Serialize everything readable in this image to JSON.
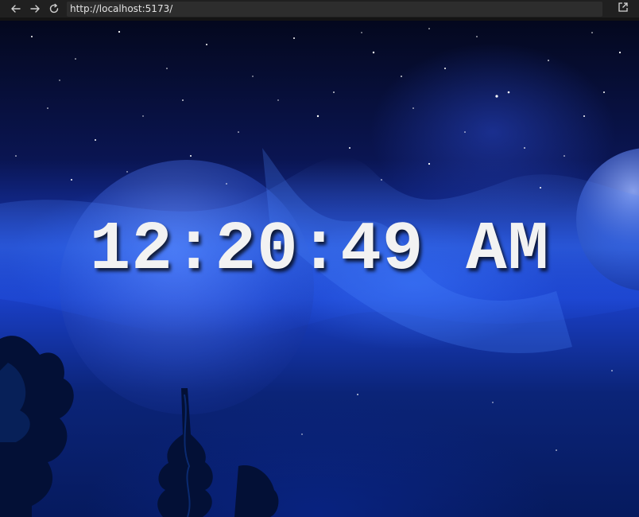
{
  "browser": {
    "url": "http://localhost:5173/",
    "icons": {
      "back": "arrow-left-icon",
      "forward": "arrow-right-icon",
      "reload": "reload-icon",
      "open_external": "open-external-icon"
    }
  },
  "clock": {
    "time": "12:20:49 AM"
  },
  "colors": {
    "sky_dark": "#04081e",
    "sky_blue": "#1a3fc6",
    "clock_text": "#f2f2f2"
  }
}
